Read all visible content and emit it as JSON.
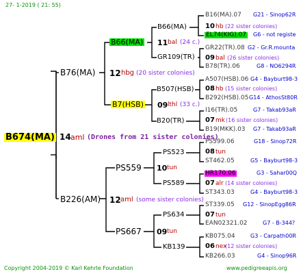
{
  "header": {
    "date": "27-  1-2019 (  21: 55)"
  },
  "root": {
    "id": "B674(MA)",
    "year": "14",
    "mark": "aml",
    "note": "(Drones from 21 sister colonies)"
  },
  "sire_line": {
    "id": "B76(MA)",
    "year": "12",
    "mark": "hbg",
    "note": "(20 sister colonies)",
    "a": {
      "id": "B66(MA)",
      "year": "11",
      "mark": "bal",
      "note": "(24 c.)",
      "a": {
        "id": "B66(MA)",
        "year": "10",
        "mark": "hb",
        "note": "(22 sister colonies)"
      },
      "b": {
        "id": "GR109(TR)",
        "year": "09",
        "mark": "bal",
        "note": "(26 sister colonies)"
      }
    },
    "b": {
      "id": "B7(HSB)",
      "year": "09",
      "mark": "lthl",
      "note": "(33 c.)",
      "a": {
        "id": "B507(HSB)",
        "year": "08",
        "mark": "hb",
        "note": "(15 sister colonies)"
      },
      "b": {
        "id": "B20(TR)",
        "year": "07",
        "mk": "mk",
        "note": "(16 sister colonies)"
      }
    }
  },
  "dam_line": {
    "id": "B226(AM)",
    "year": "12",
    "mark": "aml",
    "note": "(some sister colonies)",
    "a": {
      "id": "PS559",
      "year": "10",
      "mark": "tun",
      "a": {
        "id": "PS523",
        "year": "08",
        "mark": "tun"
      },
      "b": {
        "id": "PS589",
        "year": "07",
        "mark": "alr",
        "note": "(14 sister colonies)"
      }
    },
    "b": {
      "id": "PS667",
      "year": "09",
      "mark": "tun",
      "a": {
        "id": "PS634",
        "year": "07",
        "mark": "tun"
      },
      "b": {
        "id": "KB139",
        "year": "06",
        "mark": "nex",
        "note": "(12 sister colonies)"
      }
    }
  },
  "right_column": [
    {
      "id": "B16(MA).07",
      "info": "G21 - Sinop62R"
    },
    {
      "id": "EL74(KIG).07",
      "info": "G6 - not registe"
    },
    {
      "id": "GR22(TR).08",
      "info": "G2 - Gr.R.mounta"
    },
    {
      "id": "B78(TR).06",
      "info": "G8 - NO6294R"
    },
    {
      "id": "A507(HSB).06",
      "info": "G4 - Bayburt98-3"
    },
    {
      "id": "B292(HSB).05",
      "info": "G14 - AthosSt80R"
    },
    {
      "id": "I16(TR).05",
      "info": "G7 - Takab93aR"
    },
    {
      "id": "B19(MKK).03",
      "info": "G7 - Takab93aR"
    },
    {
      "id": "PS599.06",
      "info": "G18 - Sinop72R"
    },
    {
      "id": "ST462.05",
      "info": "G5 - Bayburt98-3"
    },
    {
      "id": "HR170.06",
      "info": "G3 - Sahar00Q"
    },
    {
      "id": "ST343.03",
      "info": "G4 - Bayburt98-3"
    },
    {
      "id": "ST339.05",
      "info": "G12 - SinopEgg86R"
    },
    {
      "id": "EAN02321.02",
      "info": "G7 - B-344?"
    },
    {
      "id": "KB075.04",
      "info": "G3 - Carpath00R"
    },
    {
      "id": "KB266.03",
      "info": "G4 - Sinop96R"
    }
  ],
  "footer": {
    "copyright": "Copyright 2004-2019 © Karl Kehrle Foundation",
    "url": "www.pedigreeapis.org"
  }
}
